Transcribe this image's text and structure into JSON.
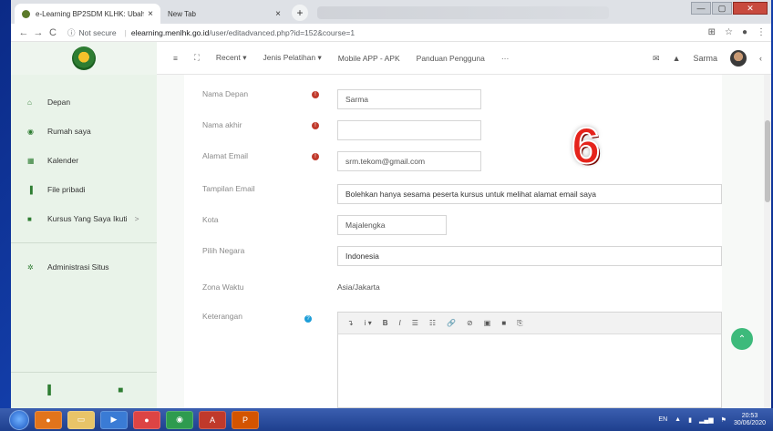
{
  "browser": {
    "tabs": [
      {
        "title": "e-Learning BP2SDM KLHK: Ubah",
        "close": "×"
      },
      {
        "title": "New Tab",
        "close": "×"
      }
    ],
    "new_tab": "+",
    "window_controls": {
      "min": "—",
      "max": "▢",
      "close": "✕"
    },
    "nav": {
      "back": "←",
      "forward": "→",
      "reload": "C"
    },
    "security": "Not secure",
    "url_host": "elearning.menlhk.go.id",
    "url_path": "/user/editadvanced.php?id=152&course=1",
    "addr_icons": {
      "translate": "⊞",
      "star": "☆",
      "profile": "●",
      "menu": "⋮"
    }
  },
  "header": {
    "menu_toggle": "≡",
    "fullscreen": "⛶",
    "menu": [
      {
        "label": "Recent ▾"
      },
      {
        "label": "Jenis Pelatihan ▾"
      },
      {
        "label": "Mobile APP - APK"
      },
      {
        "label": "Panduan Pengguna"
      },
      {
        "label": "···"
      }
    ],
    "user_name": "Sarma",
    "collapse": "‹",
    "mail_icon": "✉",
    "bell_icon": "▲"
  },
  "sidebar": {
    "items": [
      {
        "label": "Depan",
        "icon": "home-icon",
        "glyph": "⌂"
      },
      {
        "label": "Rumah saya",
        "icon": "dashboard-icon",
        "glyph": "◉"
      },
      {
        "label": "Kalender",
        "icon": "calendar-icon",
        "glyph": "▦"
      },
      {
        "label": "File pribadi",
        "icon": "file-icon",
        "glyph": "▐"
      },
      {
        "label": "Kursus Yang Saya Ikuti",
        "icon": "course-icon",
        "glyph": "■",
        "chevron": ">"
      }
    ],
    "admin": {
      "label": "Administrasi Situs",
      "icon": "cog-icon",
      "glyph": "✲"
    }
  },
  "form": {
    "fields": [
      {
        "label": "Nama Depan",
        "value": "Sarma",
        "required": true
      },
      {
        "label": "Nama akhir",
        "value": "",
        "required": true
      },
      {
        "label": "Alamat Email",
        "value": "srm.tekom@gmail.com",
        "required": true
      },
      {
        "label": "Tampilan Email",
        "value": "Bolehkan hanya sesama peserta kursus untuk melihat alamat email saya"
      },
      {
        "label": "Kota",
        "value": "Majalengka"
      },
      {
        "label": "Pilih Negara",
        "value": "Indonesia"
      },
      {
        "label": "Zona Waktu",
        "value": "Asia/Jakarta"
      },
      {
        "label": "Keterangan",
        "help": true
      }
    ],
    "req_glyph": "!",
    "help_glyph": "?",
    "editor_tools": [
      "↴",
      "i ▾",
      "B",
      "I",
      "☰",
      "☷",
      "🔗",
      "⊘",
      "▣",
      "■",
      "⎘"
    ]
  },
  "annotation": {
    "number": "6"
  },
  "scroll_top": "⌃",
  "taskbar": {
    "lang": "EN",
    "time": "20:53",
    "date": "30/06/2020"
  }
}
